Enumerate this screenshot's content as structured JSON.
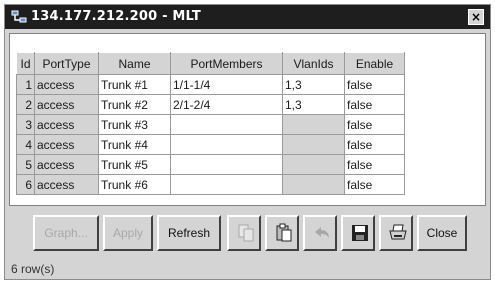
{
  "window": {
    "title": "134.177.212.200 - MLT",
    "title_icon": "network-icon",
    "close_label": "×"
  },
  "table": {
    "headers": [
      "Id",
      "PortType",
      "Name",
      "PortMembers",
      "VlanIds",
      "Enable"
    ],
    "rows": [
      {
        "id": "1",
        "porttype": "access",
        "name": "Trunk #1",
        "portmembers": "1/1-1/4",
        "vlanids": "1,3",
        "enable": "false"
      },
      {
        "id": "2",
        "porttype": "access",
        "name": "Trunk #2",
        "portmembers": "2/1-2/4",
        "vlanids": "1,3",
        "enable": "false"
      },
      {
        "id": "3",
        "porttype": "access",
        "name": "Trunk #3",
        "portmembers": "",
        "vlanids": "",
        "enable": "false"
      },
      {
        "id": "4",
        "porttype": "access",
        "name": "Trunk #4",
        "portmembers": "",
        "vlanids": "",
        "enable": "false"
      },
      {
        "id": "5",
        "porttype": "access",
        "name": "Trunk #5",
        "portmembers": "",
        "vlanids": "",
        "enable": "false"
      },
      {
        "id": "6",
        "porttype": "access",
        "name": "Trunk #6",
        "portmembers": "",
        "vlanids": "",
        "enable": "false"
      }
    ]
  },
  "toolbar": {
    "graph_label": "Graph...",
    "apply_label": "Apply",
    "refresh_label": "Refresh",
    "copy_icon": "copy-icon",
    "paste_icon": "paste-icon",
    "undo_icon": "undo-icon",
    "save_icon": "save-icon",
    "print_icon": "print-icon",
    "close_label": "Close"
  },
  "status": {
    "text": "6 row(s)"
  }
}
